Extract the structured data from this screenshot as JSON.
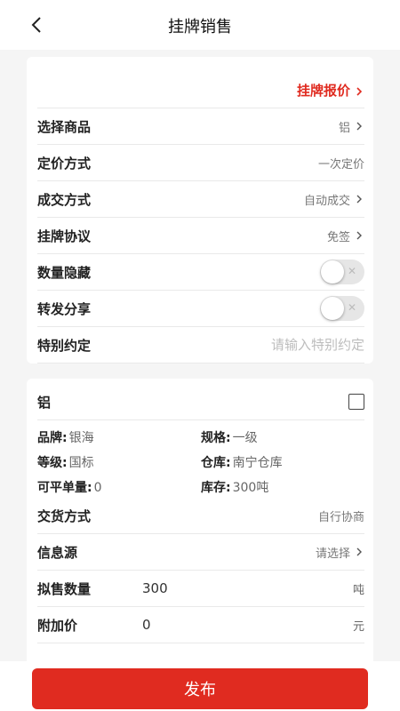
{
  "header": {
    "title": "挂牌销售"
  },
  "card1": {
    "quote_link": "挂牌报价",
    "rows": [
      {
        "label": "选择商品",
        "value": "铝"
      },
      {
        "label": "定价方式",
        "value": "一次定价"
      },
      {
        "label": "成交方式",
        "value": "自动成交"
      },
      {
        "label": "挂牌协议",
        "value": "免签"
      },
      {
        "label": "数量隐藏"
      },
      {
        "label": "转发分享"
      }
    ],
    "special": {
      "label": "特别约定",
      "placeholder": "请输入特别约定"
    }
  },
  "card2": {
    "product": "铝",
    "brand_label": "品牌:",
    "brand_value": "银海",
    "spec_label": "规格:",
    "spec_value": "一级",
    "grade_label": "等级:",
    "grade_value": "国标",
    "warehouse_label": "仓库:",
    "warehouse_value": "南宁仓库",
    "min_label": "可平单量:",
    "min_value": "0",
    "stock_label": "库存:",
    "stock_value": "300吨",
    "delivery_label": "交货方式",
    "delivery_value": "自行协商",
    "source_label": "信息源",
    "source_value": "请选择",
    "qty_label": "拟售数量",
    "qty_value": "300",
    "qty_unit": "吨",
    "extra_label": "附加价",
    "extra_value": "0",
    "extra_unit": "元"
  },
  "bottom": {
    "publish_label": "发布"
  }
}
